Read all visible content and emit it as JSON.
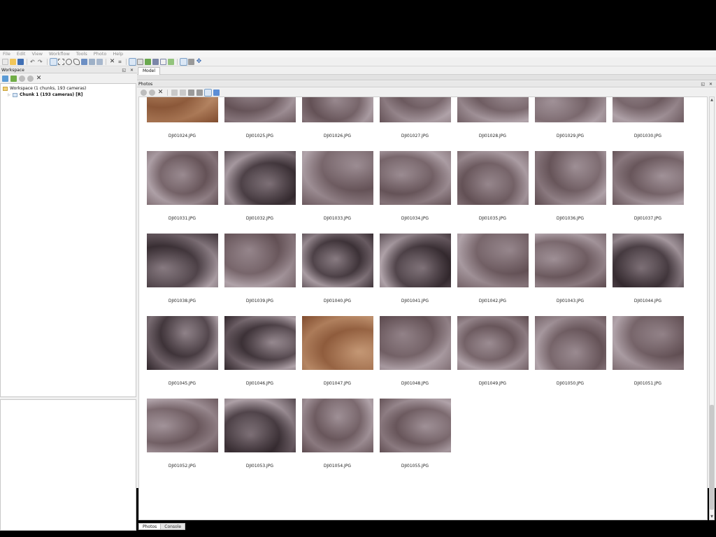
{
  "menu": [
    "File",
    "Edit",
    "View",
    "Workflow",
    "Tools",
    "Photo",
    "Help"
  ],
  "workspace": {
    "title": "Workspace",
    "tree_root": "Workspace (1 chunks, 193 cameras)",
    "tree_chunk": "Chunk 1 (193 cameras) [R]"
  },
  "model_tab": "Model",
  "photos": {
    "title": "Photos",
    "pane_controls": "◱ ✕",
    "items": [
      {
        "label": "DJI01024.JPG",
        "tone": "warm"
      },
      {
        "label": "DJI01025.JPG",
        "tone": "shell"
      },
      {
        "label": "DJI01026.JPG",
        "tone": "shell"
      },
      {
        "label": "DJI01027.JPG",
        "tone": "shell"
      },
      {
        "label": "DJI01028.JPG",
        "tone": "shell"
      },
      {
        "label": "DJI01029.JPG",
        "tone": "shell"
      },
      {
        "label": "DJI01030.JPG",
        "tone": "shell"
      },
      {
        "label": "DJI01031.JPG",
        "tone": "shell"
      },
      {
        "label": "DJI01032.JPG",
        "tone": "dark"
      },
      {
        "label": "DJI01033.JPG",
        "tone": "shell"
      },
      {
        "label": "DJI01034.JPG",
        "tone": "shell"
      },
      {
        "label": "DJI01035.JPG",
        "tone": "shell"
      },
      {
        "label": "DJI01036.JPG",
        "tone": "shell"
      },
      {
        "label": "DJI01037.JPG",
        "tone": "shell"
      },
      {
        "label": "DJI01038.JPG",
        "tone": "dark"
      },
      {
        "label": "DJI01039.JPG",
        "tone": "shell"
      },
      {
        "label": "DJI01040.JPG",
        "tone": "dark"
      },
      {
        "label": "DJI01041.JPG",
        "tone": "dark"
      },
      {
        "label": "DJI01042.JPG",
        "tone": "shell"
      },
      {
        "label": "DJI01043.JPG",
        "tone": "shell"
      },
      {
        "label": "DJI01044.JPG",
        "tone": "dark"
      },
      {
        "label": "DJI01045.JPG",
        "tone": "dark"
      },
      {
        "label": "DJI01046.JPG",
        "tone": "dark"
      },
      {
        "label": "DJI01047.JPG",
        "tone": "warm"
      },
      {
        "label": "DJI01048.JPG",
        "tone": "shell"
      },
      {
        "label": "DJI01049.JPG",
        "tone": "shell"
      },
      {
        "label": "DJI01050.JPG",
        "tone": "shell"
      },
      {
        "label": "DJI01051.JPG",
        "tone": "shell"
      },
      {
        "label": "DJI01052.JPG",
        "tone": "shell"
      },
      {
        "label": "DJI01053.JPG",
        "tone": "dark"
      },
      {
        "label": "DJI01054.JPG",
        "tone": "shell"
      },
      {
        "label": "DJI01055.JPG",
        "tone": "shell"
      }
    ]
  },
  "bottom_tabs": [
    "Photos",
    "Console"
  ],
  "colors": {
    "shell": "#9a8a8e",
    "dark": "#6e6268",
    "warm": "#b58c6e"
  }
}
